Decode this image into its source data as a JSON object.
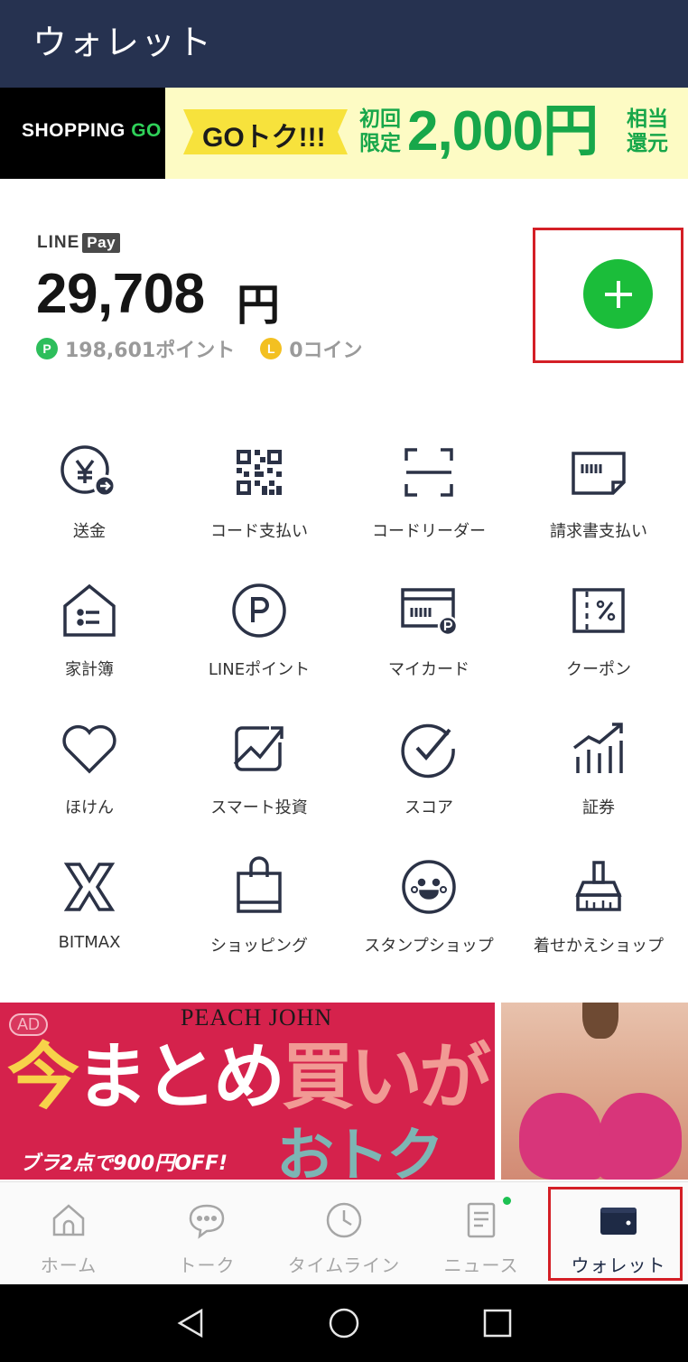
{
  "header": {
    "title": "ウォレット",
    "background": "#263250"
  },
  "promo_banner": {
    "brand_shopping": "SHOPPING",
    "brand_go": "GO",
    "tag": "GOトク!!!",
    "note_left": "初回限定",
    "amount": "2,000円",
    "note_right": "相当還元"
  },
  "line_pay": {
    "logo_line": "LINE",
    "logo_pay": "Pay",
    "balance": "29,708",
    "balance_unit": "円",
    "points_badge": "P",
    "points": "198,601ポイント",
    "coins_badge": "L",
    "coins": "0コイン",
    "add_button_icon": "plus-icon"
  },
  "menu": [
    {
      "label": "送金",
      "icon": "send-money-icon"
    },
    {
      "label": "コード支払い",
      "icon": "qr-code-icon"
    },
    {
      "label": "コードリーダー",
      "icon": "code-reader-icon"
    },
    {
      "label": "請求書支払い",
      "icon": "invoice-icon"
    },
    {
      "label": "家計簿",
      "icon": "household-book-icon"
    },
    {
      "label": "LINEポイント",
      "icon": "line-point-icon"
    },
    {
      "label": "マイカード",
      "icon": "my-card-icon"
    },
    {
      "label": "クーポン",
      "icon": "coupon-icon"
    },
    {
      "label": "ほけん",
      "icon": "heart-icon"
    },
    {
      "label": "スマート投資",
      "icon": "smart-invest-icon"
    },
    {
      "label": "スコア",
      "icon": "score-icon"
    },
    {
      "label": "証券",
      "icon": "securities-icon"
    },
    {
      "label": "BITMAX",
      "icon": "bitmax-icon"
    },
    {
      "label": "ショッピング",
      "icon": "shopping-bag-icon"
    },
    {
      "label": "スタンプショップ",
      "icon": "stamp-shop-icon"
    },
    {
      "label": "着せかえショップ",
      "icon": "theme-shop-icon"
    }
  ],
  "ad": {
    "badge": "AD",
    "brand": "PEACH JOHN",
    "headline_1": "今",
    "headline_2": "まとめ",
    "headline_3": "買い",
    "headline_4": "が",
    "subline": "おトク",
    "offer": "ブラ2点で900円OFF!"
  },
  "tabs": [
    {
      "label": "ホーム",
      "icon": "home-icon",
      "active": false
    },
    {
      "label": "トーク",
      "icon": "chat-icon",
      "active": false
    },
    {
      "label": "タイムライン",
      "icon": "clock-icon",
      "active": false
    },
    {
      "label": "ニュース",
      "icon": "news-icon",
      "active": false
    },
    {
      "label": "ウォレット",
      "icon": "wallet-icon",
      "active": true
    }
  ],
  "system_nav": [
    "back-icon",
    "home-circle-icon",
    "recents-icon"
  ],
  "colors": {
    "accent_green": "#1bbd3a",
    "highlight_red": "#d41f26",
    "ad_red": "#d5224c"
  }
}
